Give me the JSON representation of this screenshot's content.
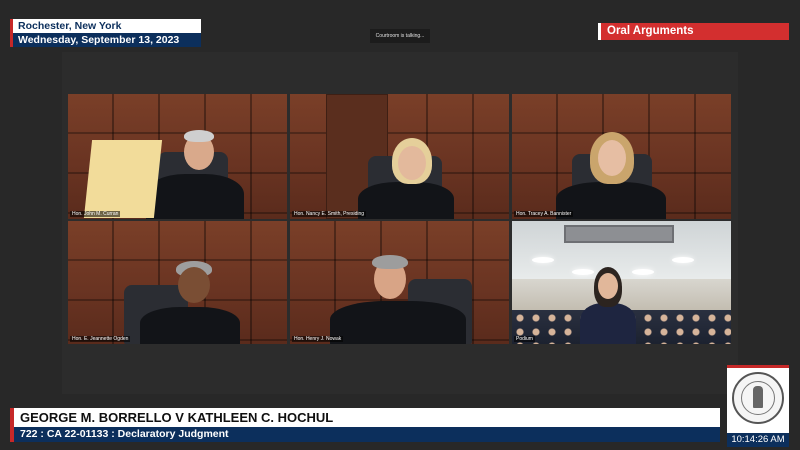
{
  "header": {
    "city": "Rochester, New York",
    "date": "Wednesday, September 13, 2023",
    "status": "Courtroom is talking...",
    "session_label": "Oral Arguments"
  },
  "participants": [
    {
      "name": "Hon. John M. Curran"
    },
    {
      "name": "Hon. Nancy E. Smith, Presiding"
    },
    {
      "name": "Hon. Tracey A. Bannister"
    },
    {
      "name": "Hon. E. Jeannette Ogden"
    },
    {
      "name": "Hon. Henry J. Nowak"
    },
    {
      "name": "Podium"
    }
  ],
  "case": {
    "title": "GEORGE M. BORRELLO V KATHLEEN C. HOCHUL",
    "docket": "722 : CA  22-01133 : Declaratory Judgment"
  },
  "clock": "10:14:26 AM",
  "colors": {
    "accent_red": "#d32f2f",
    "navy": "#0c2f5c"
  }
}
